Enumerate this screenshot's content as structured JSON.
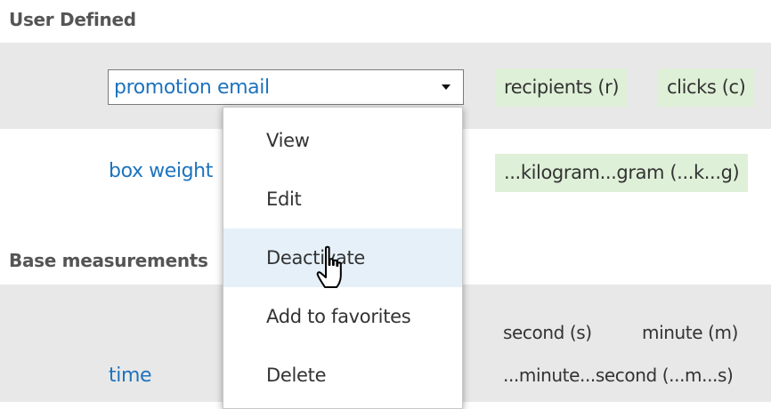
{
  "sections": {
    "user_defined_title": "User Defined",
    "base_measurements_title": "Base measurements"
  },
  "row1": {
    "selected_value": "promotion email",
    "chips": [
      "recipients (r)",
      "clicks (c)"
    ]
  },
  "row2": {
    "link": "box weight",
    "chip": "...kilogram...gram (...k...g)"
  },
  "row3": {
    "units": [
      "second (s)",
      "minute (m)"
    ],
    "link": "time",
    "formula": "...minute...second (...m...s)"
  },
  "context_menu": {
    "items": [
      "View",
      "Edit",
      "Deactivate",
      "Add to favorites",
      "Delete"
    ],
    "hovered": "Deactivate"
  },
  "colors": {
    "link": "#1e73be",
    "band": "#e8e8e8",
    "chip": "#dff0d8",
    "menu_hover": "#e5f0f9"
  }
}
